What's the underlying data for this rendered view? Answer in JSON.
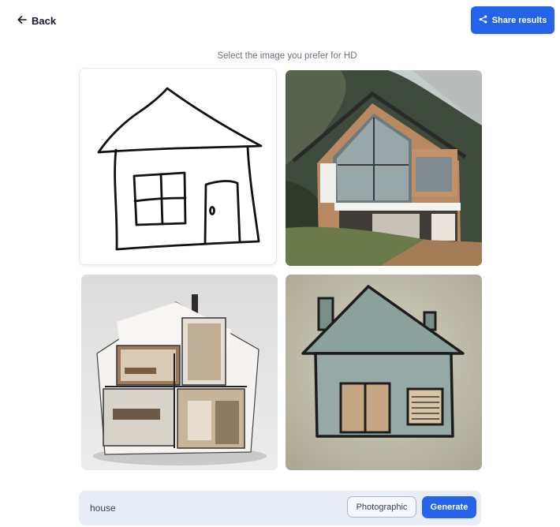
{
  "header": {
    "back_label": "Back",
    "share_label": "Share results"
  },
  "subtitle": "Select the image you prefer for HD",
  "images": [
    {
      "name": "sketch"
    },
    {
      "name": "photographic-house"
    },
    {
      "name": "cutaway-interior-house"
    },
    {
      "name": "painted-house"
    }
  ],
  "prompt": {
    "value": "house",
    "style_label": "Photographic",
    "generate_label": "Generate"
  },
  "colors": {
    "accent": "#2563eb",
    "prompt_bar": "#e9edf7"
  }
}
